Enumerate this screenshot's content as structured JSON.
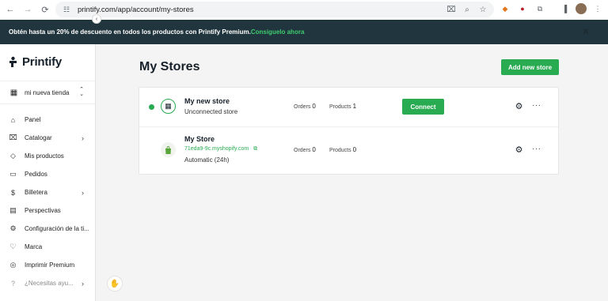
{
  "browser": {
    "url": "printify.com/app/account/my-stores",
    "icons": [
      "back-icon",
      "forward-icon",
      "reload-icon",
      "site-info-icon",
      "translate-icon",
      "zoom-icon",
      "bookmark-star-icon",
      "metamask-icon",
      "extension-icon",
      "puzzle-icon",
      "sidebar-icon",
      "avatar",
      "kebab-icon"
    ]
  },
  "banner": {
    "text": "Obtén hasta un 20% de descuento en todos los productos con Printify Premium.",
    "link": "Consiguelo ahora"
  },
  "sidebar": {
    "logo": "Printify",
    "store_selector": "mi nueva tienda",
    "items": [
      {
        "label": "Panel",
        "icon": "home-icon"
      },
      {
        "label": "Catalogar",
        "icon": "tag-icon"
      },
      {
        "label": "Mis productos",
        "icon": "tags-icon"
      },
      {
        "label": "Pedidos",
        "icon": "truck-icon"
      },
      {
        "label": "Billetera",
        "icon": "dollar-icon"
      },
      {
        "label": "Perspectivas",
        "icon": "chart-icon"
      },
      {
        "label": "Configuración de la ti...",
        "icon": "gear-icon"
      },
      {
        "label": "Marca",
        "icon": "heart-icon"
      },
      {
        "label": "Imprimir Premium",
        "icon": "medal-icon"
      },
      {
        "label": "¿Necesitas ayu...",
        "icon": "help-icon"
      }
    ]
  },
  "main": {
    "title": "My Stores",
    "add_button": "Add new store",
    "stores": [
      {
        "name": "My new store",
        "subtitle": "Unconnected store",
        "orders_label": "Orders",
        "orders": "0",
        "products_label": "Products",
        "products": "1",
        "connect_label": "Connect"
      },
      {
        "name": "My Store",
        "link": "71eda9-9c.myshopify.com",
        "subtitle": "Automatic (24h)",
        "orders_label": "Orders",
        "orders": "0",
        "products_label": "Products",
        "products": "0"
      }
    ]
  },
  "colors": {
    "brand_green": "#29ab51",
    "banner_bg": "#20353d",
    "text_dark": "#16202a"
  }
}
